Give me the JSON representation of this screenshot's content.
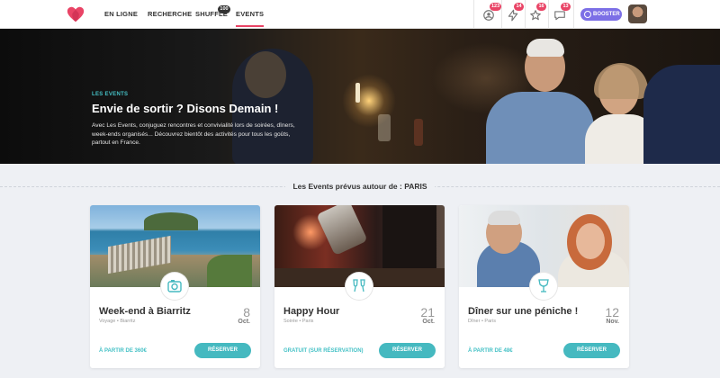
{
  "nav": {
    "links": [
      {
        "label": "EN LIGNE"
      },
      {
        "label": "RECHERCHE"
      },
      {
        "label": "SHUFFLE",
        "badge": "100"
      },
      {
        "label": "EVENTS"
      }
    ],
    "counts": {
      "visits": "123",
      "flashes": "14",
      "favorites": "16",
      "messages": "13"
    },
    "booster": "BOOSTER"
  },
  "hero": {
    "kicker": "LES EVENTS",
    "title": "Envie de sortir ? Disons Demain !",
    "description": "Avec Les Events, conjuguez rencontres et convivialité lors de soirées, dîners, week-ends organisés... Découvrez bientôt des activités pour tous les goûts, partout en France."
  },
  "section": {
    "title": "Les Events prévus autour de : PARIS"
  },
  "events": [
    {
      "title": "Week-end à Biarritz",
      "subtitle": "Voyage • Biarritz",
      "day": "8",
      "month": "Oct.",
      "price": "À PARTIR DE 360€",
      "button": "RÉSERVER",
      "icon": "camera-icon"
    },
    {
      "title": "Happy Hour",
      "subtitle": "Soirée • Paris",
      "day": "21",
      "month": "Oct.",
      "price": "GRATUIT (SUR RÉSERVATION)",
      "button": "RÉSERVER",
      "icon": "cheers-glasses-icon"
    },
    {
      "title": "Dîner sur une péniche !",
      "subtitle": "Dîner • Paris",
      "day": "12",
      "month": "Nov.",
      "price": "À PARTIR DE 48€",
      "button": "RÉSERVER",
      "icon": "wine-glass-icon"
    }
  ],
  "colors": {
    "accent": "#45b9c0",
    "brand": "#e94466",
    "booster": "#7c6fe6"
  }
}
